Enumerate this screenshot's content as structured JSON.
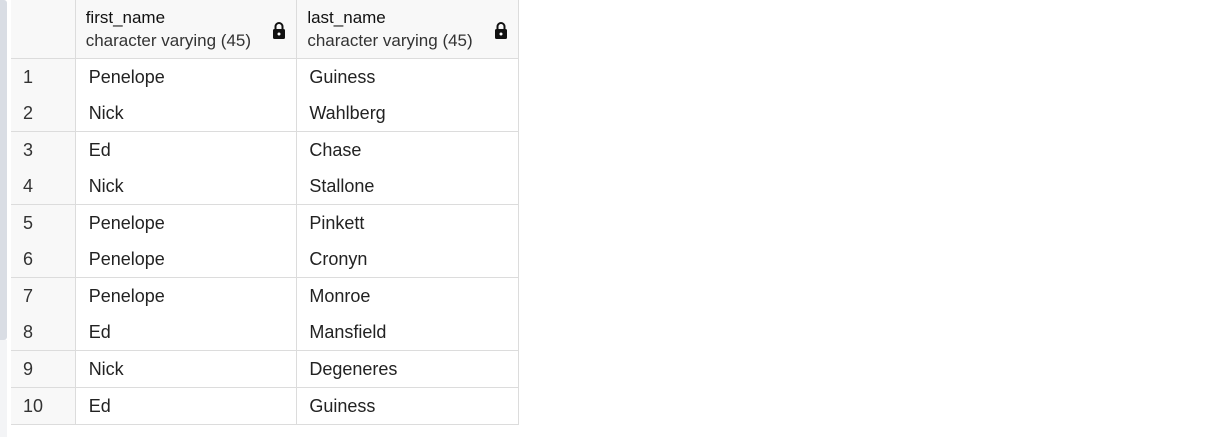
{
  "columns": [
    {
      "name": "first_name",
      "type": "character varying (45)",
      "locked": true,
      "icon": "lock-icon"
    },
    {
      "name": "last_name",
      "type": "character varying (45)",
      "locked": true,
      "icon": "lock-icon"
    }
  ],
  "rows": [
    {
      "num": "1",
      "first_name": "Penelope",
      "last_name": "Guiness"
    },
    {
      "num": "2",
      "first_name": "Nick",
      "last_name": "Wahlberg"
    },
    {
      "num": "3",
      "first_name": "Ed",
      "last_name": "Chase"
    },
    {
      "num": "4",
      "first_name": "Nick",
      "last_name": "Stallone"
    },
    {
      "num": "5",
      "first_name": "Penelope",
      "last_name": "Pinkett"
    },
    {
      "num": "6",
      "first_name": "Penelope",
      "last_name": "Cronyn"
    },
    {
      "num": "7",
      "first_name": "Penelope",
      "last_name": "Monroe"
    },
    {
      "num": "8",
      "first_name": "Ed",
      "last_name": "Mansfield"
    },
    {
      "num": "9",
      "first_name": "Nick",
      "last_name": "Degeneres"
    },
    {
      "num": "10",
      "first_name": "Ed",
      "last_name": "Guiness"
    }
  ]
}
